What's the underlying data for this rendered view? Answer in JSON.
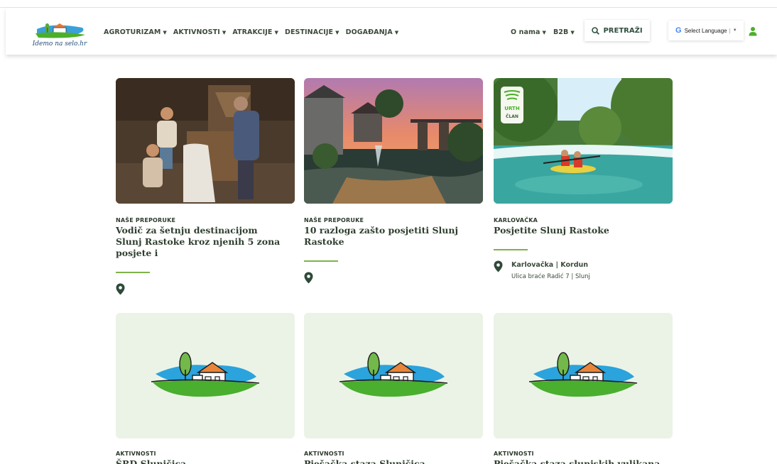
{
  "header": {
    "logo_text": "Idemo na selo.hr",
    "nav": [
      {
        "label": "AGROTURIZAM"
      },
      {
        "label": "AKTIVNOSTI"
      },
      {
        "label": "ATRAKCIJE"
      },
      {
        "label": "DESTINACIJE"
      },
      {
        "label": "DOGAĐANJA"
      }
    ],
    "nav_right": [
      {
        "label": "O nama"
      },
      {
        "label": "B2B"
      }
    ],
    "search_label": "PRETRAŽI",
    "language_label": "Select Language",
    "language_sep": "|",
    "language_caret": "▼",
    "google_letter": "G",
    "caret": "▼"
  },
  "cards": [
    {
      "category": "NAŠE PREPORUKE",
      "title": "Vodič za šetnju destinacijom Slunj Rastoke kroz njenih 5 zona posjete i",
      "location": "",
      "address": ""
    },
    {
      "category": "NAŠE PREPORUKE",
      "title": "10 razloga zašto posjetiti Slunj Rastoke",
      "location": "",
      "address": ""
    },
    {
      "category": "KARLOVAČKA",
      "title": "Posjetite Slunj Rastoke",
      "location": "Karlovačka | Kordun",
      "address": "Ulica braće Radić 7 | Slunj",
      "badge": "URTH ČLAN"
    }
  ],
  "cards_row2": [
    {
      "category": "AKTIVNOSTI",
      "title": "ŠRD Slunjčica"
    },
    {
      "category": "AKTIVNOSTI",
      "title": "Pješačka staza Slunjčica"
    },
    {
      "category": "AKTIVNOSTI",
      "title": "Pješačka staza slunjskih vulikana"
    }
  ],
  "colors": {
    "accent_green": "#7fb24a",
    "text_dark": "#2f3f2f",
    "placeholder_bg": "#ebf3e7"
  }
}
